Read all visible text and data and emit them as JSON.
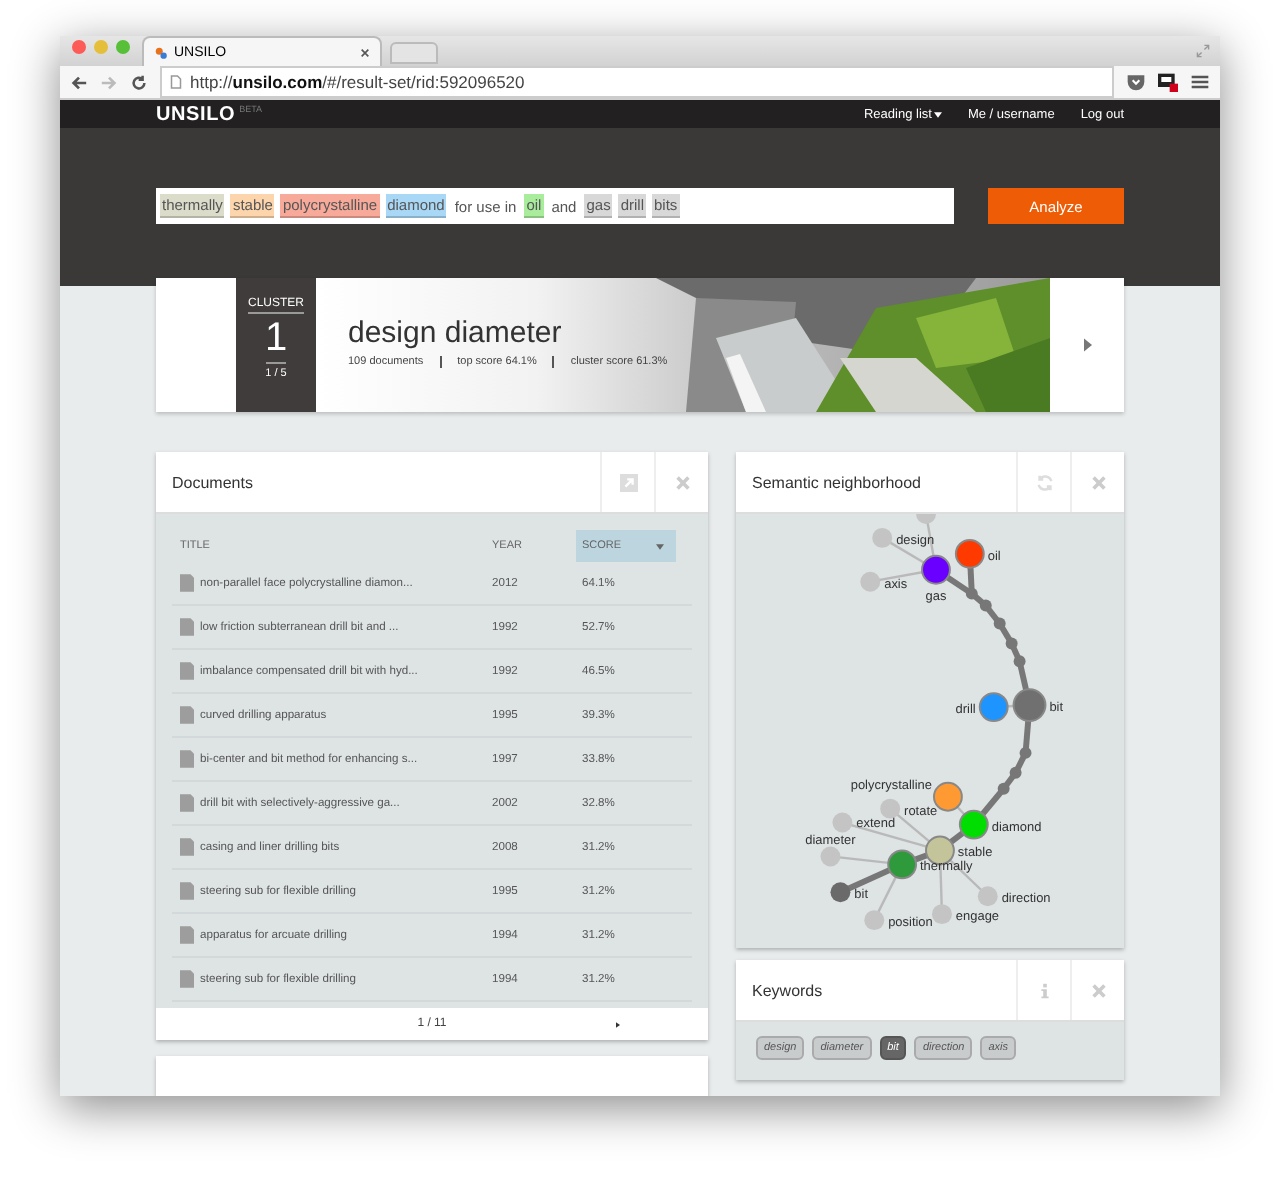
{
  "browser": {
    "tab_title": "UNSILO",
    "url": "http://**unsilo.com**/#/result-set/rid:592096520"
  },
  "nav": {
    "logo": "UNSILO",
    "badge": "BETA",
    "links": [
      {
        "label": "Reading list",
        "kind": "dropdown"
      },
      {
        "label": "Me / username",
        "kind": "link"
      },
      {
        "label": "Log out",
        "kind": "link"
      }
    ]
  },
  "query": {
    "tokens": [
      {
        "text": "thermally",
        "color": "#dcdccb"
      },
      {
        "text": "stable",
        "color": "#fdd5ad"
      },
      {
        "text": "polycrystalline",
        "color": "#f7a99a"
      },
      {
        "text": "diamond",
        "color": "#a9d8f7"
      },
      {
        "text": "for use in"
      },
      {
        "text": "oil",
        "color": "#a8ec9c"
      },
      {
        "text": "and"
      },
      {
        "text": "gas",
        "color": "#d8d8d8"
      },
      {
        "text": "drill",
        "color": "#d8d8d8"
      },
      {
        "text": "bits",
        "color": "#d8d8d8"
      }
    ],
    "button": "Analyze"
  },
  "cluster": {
    "label": "CLUSTER",
    "number": "1",
    "position": "1 / 5",
    "title": "design diameter",
    "stats": [
      "109 documents",
      "top score 64.1%",
      "cluster score 61.3%"
    ]
  },
  "documents": {
    "title": "Documents",
    "columns": [
      {
        "label": "TITLE",
        "selected": false
      },
      {
        "label": "YEAR",
        "selected": false
      },
      {
        "label": "SCORE",
        "selected": true
      }
    ],
    "rows": [
      {
        "title": "non-parallel face polycrystalline diamon...",
        "year": "2012",
        "score": "64.1%"
      },
      {
        "title": "low friction subterranean drill bit and ...",
        "year": "1992",
        "score": "52.7%"
      },
      {
        "title": "imbalance compensated drill bit with hyd...",
        "year": "1992",
        "score": "46.5%"
      },
      {
        "title": "curved drilling apparatus",
        "year": "1995",
        "score": "39.3%"
      },
      {
        "title": "bi-center and bit method for enhancing s...",
        "year": "1997",
        "score": "33.8%"
      },
      {
        "title": "drill bit with selectively-aggressive ga...",
        "year": "2002",
        "score": "32.8%"
      },
      {
        "title": "casing and liner drilling bits",
        "year": "2008",
        "score": "31.2%"
      },
      {
        "title": "steering sub for flexible drilling",
        "year": "1995",
        "score": "31.2%"
      },
      {
        "title": "apparatus for arcuate drilling",
        "year": "1994",
        "score": "31.2%"
      },
      {
        "title": "steering sub for flexible drilling",
        "year": "1994",
        "score": "31.2%"
      }
    ],
    "pager": "1 / 11"
  },
  "semantic": {
    "title": "Semantic neighborhood",
    "nodes": [
      {
        "label": "design",
        "color": "#c4c4c4"
      },
      {
        "label": "axis",
        "color": "#c4c4c4"
      },
      {
        "label": "oil",
        "color": "#ff3a00"
      },
      {
        "label": "gas",
        "color": "#6a00ff"
      },
      {
        "label": "drill",
        "color": "#1e94ff"
      },
      {
        "label": "bit",
        "color": "#707070"
      },
      {
        "label": "polycrystalline",
        "color": "#ff9a33"
      },
      {
        "label": "rotate",
        "color": "#c4c4c4"
      },
      {
        "label": "diamond",
        "color": "#00dd00"
      },
      {
        "label": "extend",
        "color": "#c4c4c4"
      },
      {
        "label": "stable",
        "color": "#c4c49a"
      },
      {
        "label": "diameter",
        "color": "#c4c4c4"
      },
      {
        "label": "thermally",
        "color": "#2f9a3c"
      },
      {
        "label": "bit",
        "color": "#6a6a6a"
      },
      {
        "label": "position",
        "color": "#c4c4c4"
      },
      {
        "label": "engage",
        "color": "#c4c4c4"
      },
      {
        "label": "direction",
        "color": "#c4c4c4"
      }
    ]
  },
  "keywords": {
    "title": "Keywords",
    "tags": [
      {
        "text": "design",
        "selected": false
      },
      {
        "text": "diameter",
        "selected": false
      },
      {
        "text": "bit",
        "selected": true
      },
      {
        "text": "direction",
        "selected": false
      },
      {
        "text": "axis",
        "selected": false
      }
    ]
  }
}
